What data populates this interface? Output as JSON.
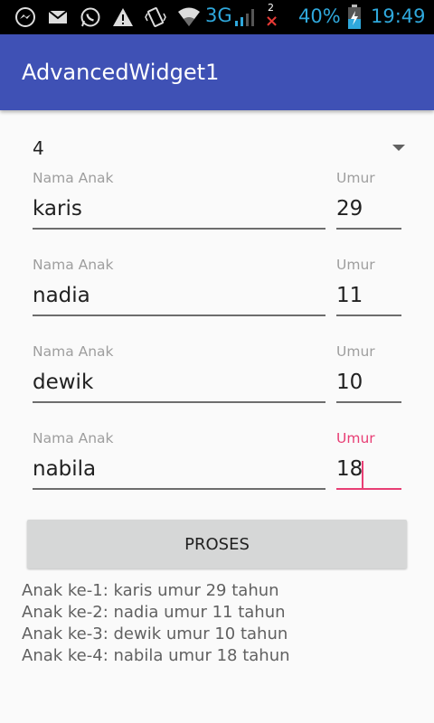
{
  "status_bar": {
    "network": "3G",
    "battery": "40%",
    "time": "19:49",
    "notification_count": "2",
    "icons": [
      "messenger-icon",
      "gmail-icon",
      "whatsapp-icon",
      "warning-icon",
      "vibrate-icon",
      "wifi-icon",
      "signal-icon",
      "battery-icon"
    ]
  },
  "app_bar": {
    "title": "AdvancedWidget1"
  },
  "spinner": {
    "selected": "4"
  },
  "children": [
    {
      "name_label": "Nama Anak",
      "name": "karis",
      "age_label": "Umur",
      "age": "29"
    },
    {
      "name_label": "Nama Anak",
      "name": "nadia",
      "age_label": "Umur",
      "age": "11"
    },
    {
      "name_label": "Nama Anak",
      "name": "dewik",
      "age_label": "Umur",
      "age": "10"
    },
    {
      "name_label": "Nama Anak",
      "name": "nabila",
      "age_label": "Umur",
      "age": "18"
    }
  ],
  "button": {
    "label": "PROSES"
  },
  "result_lines": [
    "Anak ke-1: karis umur 29 tahun",
    "Anak ke-2: nadia umur 11 tahun",
    "Anak ke-3: dewik umur 10 tahun",
    "Anak ke-4: nabila umur 18 tahun"
  ],
  "colors": {
    "primary": "#3f51b5",
    "accent": "#e83e74",
    "status_text": "#2fa8dc"
  }
}
